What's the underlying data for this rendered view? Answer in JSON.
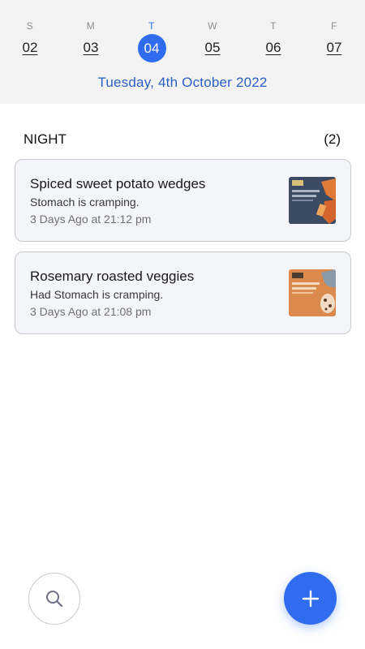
{
  "calendar": {
    "days": [
      {
        "letter": "S",
        "num": "02"
      },
      {
        "letter": "M",
        "num": "03"
      },
      {
        "letter": "T",
        "num": "04",
        "selected": true
      },
      {
        "letter": "W",
        "num": "05"
      },
      {
        "letter": "T",
        "num": "06"
      },
      {
        "letter": "F",
        "num": "07"
      }
    ],
    "selected_date": "Tuesday, 4th October 2022",
    "accent_color": "#2f6cf0"
  },
  "section": {
    "title": "NIGHT",
    "count": "(2)"
  },
  "entries": [
    {
      "title": "Spiced sweet potato wedges",
      "description": "Stomach is cramping.",
      "time": "3 Days Ago at 21:12 pm",
      "thumb_color": "#3d4a63"
    },
    {
      "title": "Rosemary roasted veggies",
      "description": "Had Stomach is cramping.",
      "time": "3 Days Ago at 21:08 pm",
      "thumb_color": "#d98a4c"
    }
  ],
  "actions": {
    "search_icon": "search-icon",
    "add_icon": "plus-icon"
  }
}
